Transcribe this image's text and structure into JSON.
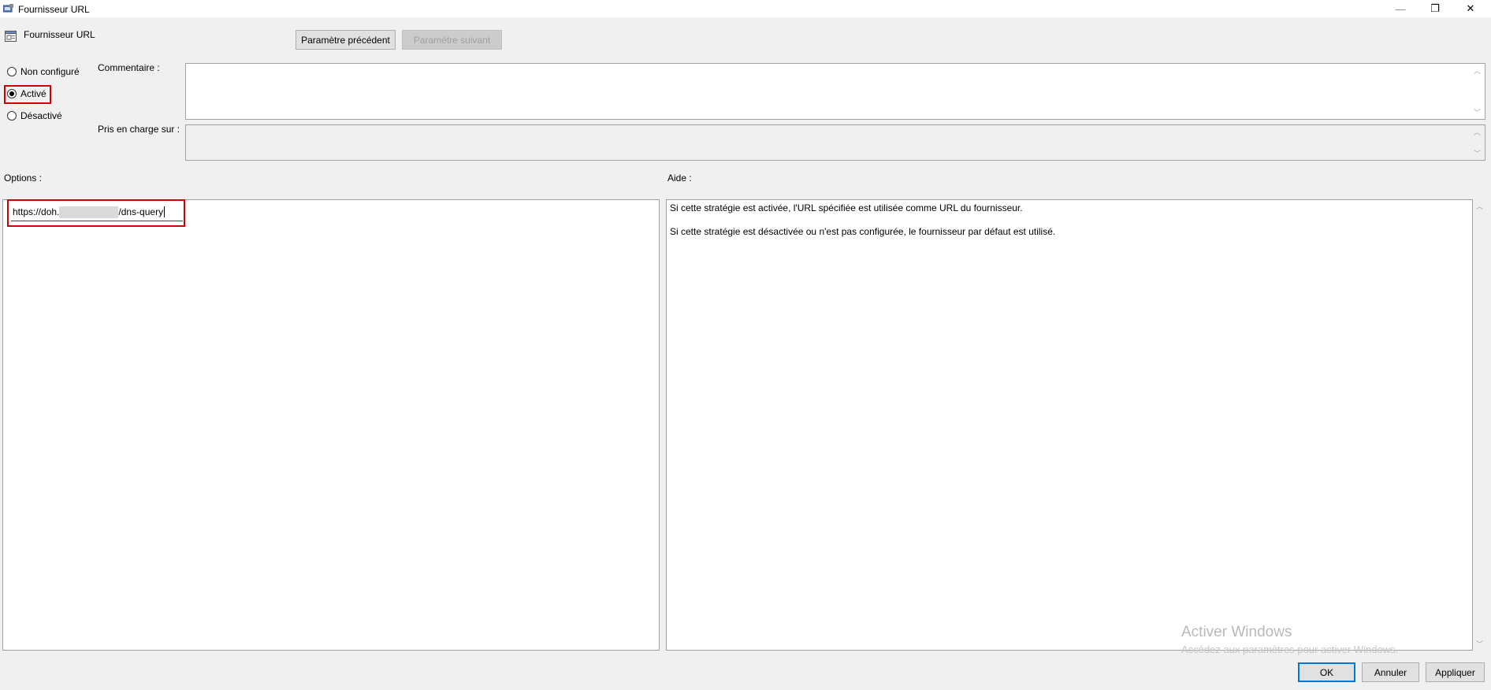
{
  "window": {
    "title": "Fournisseur URL",
    "minimize_glyph": "—",
    "restore_glyph": "❐",
    "close_glyph": "✕"
  },
  "header": {
    "policy_name": "Fournisseur URL",
    "prev_button": "Paramètre précédent",
    "next_button": "Paramètre suivant"
  },
  "state": {
    "options": [
      "Non configuré",
      "Activé",
      "Désactivé"
    ],
    "selected": "Activé"
  },
  "comment": {
    "label": "Commentaire :",
    "value": ""
  },
  "supported": {
    "label": "Pris en charge sur :",
    "value": ""
  },
  "options_panel": {
    "label": "Options :",
    "url_prefix": "https://doh.",
    "url_suffix": "/dns-query"
  },
  "help_panel": {
    "label": "Aide :",
    "lines": [
      "Si cette stratégie est activée, l'URL spécifiée est utilisée comme URL du fournisseur.",
      "Si cette stratégie est désactivée ou n'est pas configurée, le fournisseur par défaut est utilisé."
    ]
  },
  "watermark": {
    "title": "Activer Windows",
    "subtitle": "Accédez aux paramètres pour activer Windows."
  },
  "footer": {
    "ok": "OK",
    "cancel": "Annuler",
    "apply": "Appliquer"
  },
  "colors": {
    "highlight_border": "#d00000",
    "accent": "#0078d7"
  }
}
